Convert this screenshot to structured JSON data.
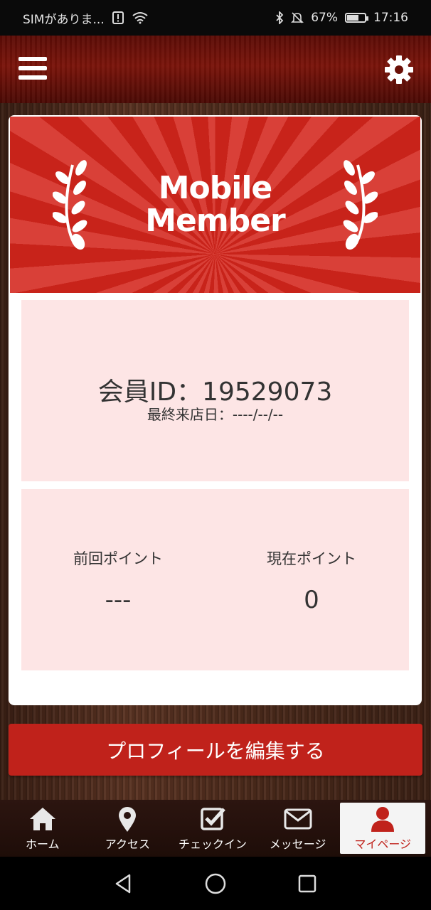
{
  "status_bar": {
    "carrier": "SIMがありま...",
    "battery_percent": "67%",
    "time": "17:16",
    "icons": [
      "alert-icon",
      "wifi-icon",
      "bluetooth-icon",
      "mute-icon",
      "battery-icon"
    ]
  },
  "header": {
    "menu_icon": "hamburger-icon",
    "settings_icon": "gear-icon"
  },
  "banner": {
    "title_line1": "Mobile",
    "title_line2": "Member",
    "decoration": "laurel-icon"
  },
  "member": {
    "id_label": "会員ID：",
    "id_value": "19529073",
    "last_visit_label": "最終来店日：",
    "last_visit_value": "----/--/--"
  },
  "points": {
    "previous_label": "前回ポイント",
    "previous_value": "---",
    "current_label": "現在ポイント",
    "current_value": "0"
  },
  "edit_profile_button": "プロフィールを編集する",
  "tabs": [
    {
      "label": "ホーム",
      "icon": "home-icon"
    },
    {
      "label": "アクセス",
      "icon": "map-pin-icon"
    },
    {
      "label": "チェックイン",
      "icon": "checkbox-icon"
    },
    {
      "label": "メッセージ",
      "icon": "mail-icon"
    },
    {
      "label": "マイページ",
      "icon": "user-icon",
      "active": true
    }
  ],
  "colors": {
    "accent": "#c0221b",
    "panel_bg": "#fde5e5",
    "header_dark": "#5b0c06"
  },
  "system_nav": [
    "back-icon",
    "home-circle-icon",
    "recents-icon"
  ]
}
